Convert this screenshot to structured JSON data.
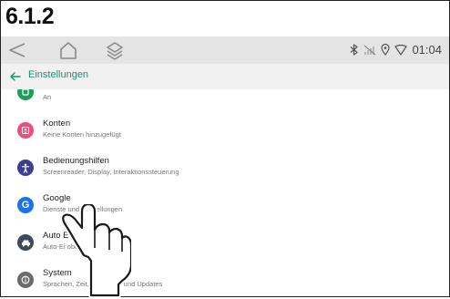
{
  "step_label": "6.1.2",
  "status": {
    "time": "01:04"
  },
  "appbar": {
    "title": "Einstellungen"
  },
  "items": [
    {
      "title": "",
      "subtitle": "An",
      "icon": "green-settings-icon",
      "color": "#1e9e5a"
    },
    {
      "title": "Konten",
      "subtitle": "Keine Konten hinzugefügt",
      "icon": "account-icon",
      "color": "#e84f7a"
    },
    {
      "title": "Bedienungshilfen",
      "subtitle": "Screenreader, Display, Interaktionssteuerung",
      "icon": "accessibility-icon",
      "color": "#3b3f8f"
    },
    {
      "title": "Google",
      "subtitle": "Dienste und Einstellungen",
      "icon": "google-icon",
      "color": "#1a73e8"
    },
    {
      "title": "Auto E",
      "subtitle": "Auto-Ei          oberfläche",
      "icon": "car-icon",
      "color": "#3c4a5a"
    },
    {
      "title": "System",
      "subtitle": "Sprachen, Zeit, Sicherung und Updates",
      "icon": "system-info-icon",
      "color": "#6b6b6b"
    }
  ]
}
